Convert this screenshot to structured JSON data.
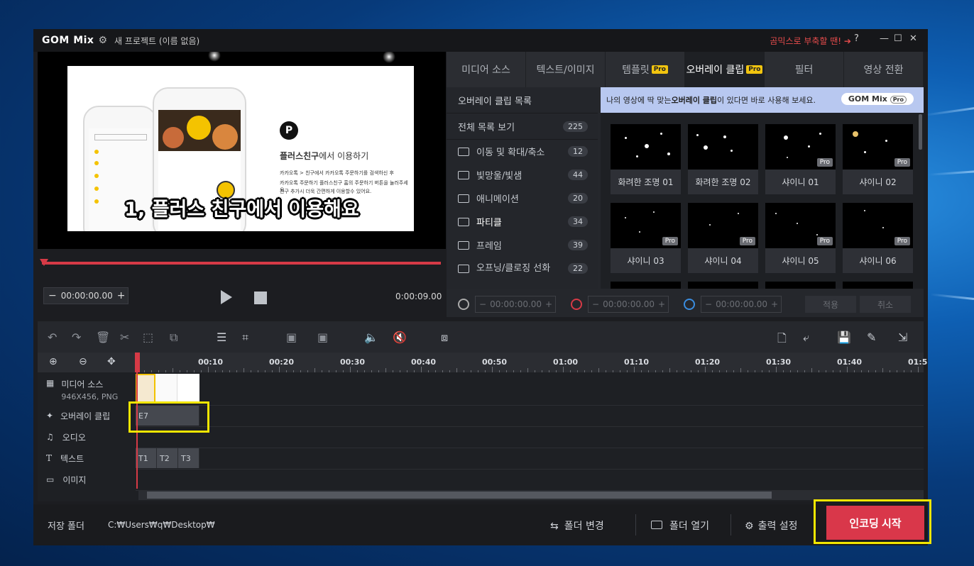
{
  "app": {
    "logo": "GOM Mix",
    "project_name": "새 프로젝트 (이름 없음)",
    "promo_text": "곰믹스로 부축할 땐! ➔",
    "help": "?",
    "minimize": "—",
    "maximize": "☐",
    "close": "✕"
  },
  "preview": {
    "subtitle": "1, 플러스 친구에서 이용해요",
    "slide_heading_bold": "플러스친구",
    "slide_heading_rest": "에서 이용하기",
    "slide_line1": "카카오톡 > 친구에서 카카오톡 주문하기를 검색하신 후",
    "slide_line2": "카카오톡 주문하기 플러스친구 홈의 주문하기 버튼을 눌러주세요.",
    "slide_line3": "친구 추가시 더욱 간편하게 이용할수 있어요."
  },
  "player": {
    "current_time": "00:00:00.00",
    "total_time": "0:00:09.00",
    "minus": "−",
    "plus": "+"
  },
  "tabs": [
    {
      "label": "미디어 소스",
      "pro": ""
    },
    {
      "label": "텍스트/이미지",
      "pro": ""
    },
    {
      "label": "템플릿",
      "pro": "Pro"
    },
    {
      "label": "오버레이 클립",
      "pro": "Pro"
    },
    {
      "label": "필터",
      "pro": ""
    },
    {
      "label": "영상 전환",
      "pro": ""
    }
  ],
  "overlay": {
    "list_title": "오버레이 클립 목록",
    "all_label": "전체 목록 보기",
    "all_count": "225",
    "categories": [
      {
        "label": "이동 및 확대/축소",
        "count": "12"
      },
      {
        "label": "빛망울/빛샘",
        "count": "44"
      },
      {
        "label": "애니메이션",
        "count": "20"
      },
      {
        "label": "파티클",
        "count": "34"
      },
      {
        "label": "프레임",
        "count": "39"
      },
      {
        "label": "오프닝/클로징 선화",
        "count": "22"
      }
    ],
    "banner_text_1": "나의 영상에 딱 맞는 ",
    "banner_text_bold": "오버레이 클립",
    "banner_text_2": "이 있다면 바로 사용해 보세요.",
    "banner_logo": "GOM Mix",
    "banner_pro": "Pro",
    "thumbs": [
      {
        "label": "화려한 조명 01",
        "pro": ""
      },
      {
        "label": "화려한 조명 02",
        "pro": ""
      },
      {
        "label": "샤이니 01",
        "pro": "Pro"
      },
      {
        "label": "샤이니 02",
        "pro": "Pro"
      },
      {
        "label": "샤이니 03",
        "pro": "Pro"
      },
      {
        "label": "샤이니 04",
        "pro": "Pro"
      },
      {
        "label": "샤이니 05",
        "pro": "Pro"
      },
      {
        "label": "샤이니 06",
        "pro": "Pro"
      }
    ],
    "timecode_1": "00:00:00.00",
    "timecode_2": "00:00:00.00",
    "timecode_3": "00:00:00.00",
    "apply": "적용",
    "cancel": "취소"
  },
  "timeline": {
    "ruler_labels": [
      "00:10",
      "00:20",
      "00:30",
      "00:40",
      "00:50",
      "01:00",
      "01:10",
      "01:20",
      "01:30",
      "01:40",
      "01:5"
    ],
    "tracks": [
      {
        "label": "미디어 소스",
        "sub": "946X456, PNG"
      },
      {
        "label": "오버레이 클립",
        "sub": ""
      },
      {
        "label": "오디오",
        "sub": ""
      },
      {
        "label": "텍스트",
        "sub": ""
      },
      {
        "label": "이미지",
        "sub": ""
      }
    ],
    "overlay_clip": "E7",
    "text_clips": [
      "T1",
      "T2",
      "T3"
    ]
  },
  "status": {
    "save_folder_label": "저장 폴더",
    "save_path": "C:₩Users₩q₩Desktop₩",
    "change_folder": "폴더 변경",
    "open_folder": "폴더 열기",
    "output_settings": "출력 설정",
    "encode_start": "인코딩 시작"
  },
  "colors": {
    "accent_red": "#d9374a",
    "highlight_yellow": "#f2e600",
    "pro_badge": "#f1c40f"
  }
}
